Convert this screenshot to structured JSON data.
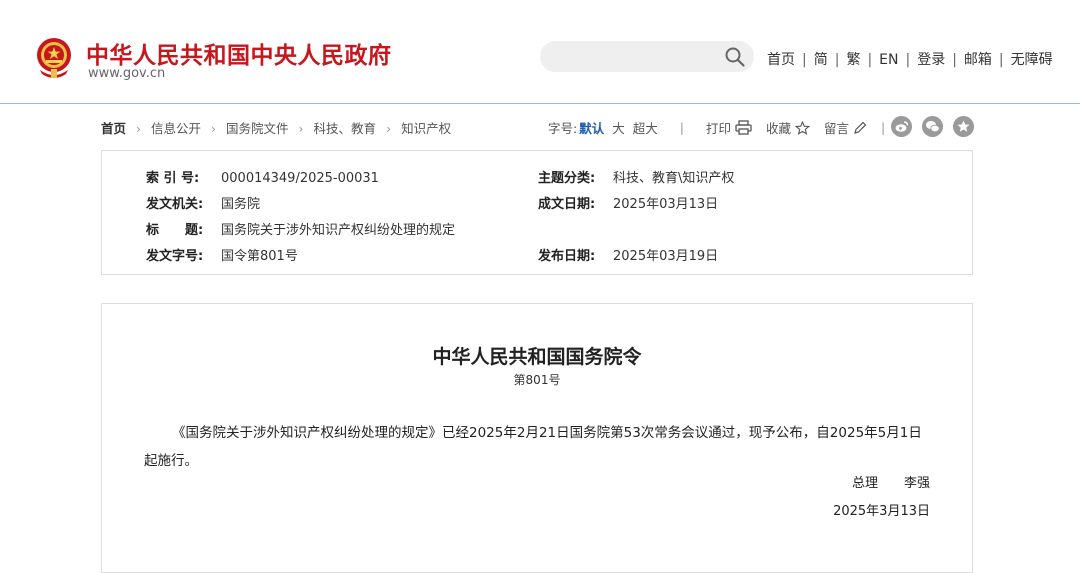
{
  "header": {
    "site_title": "中华人民共和国中央人民政府",
    "site_domain": "www.gov.cn",
    "emblem_icon": "national-emblem-icon",
    "search": {
      "value": "",
      "placeholder": ""
    },
    "nav": [
      "首页",
      "简",
      "繁",
      "EN",
      "登录",
      "邮箱",
      "无障碍"
    ]
  },
  "breadcrumb": [
    "首页",
    "信息公开",
    "国务院文件",
    "科技、教育",
    "知识产权"
  ],
  "toolbar": {
    "font_size_label": "字号:",
    "font_default": "默认",
    "font_large": "大",
    "font_xlarge": "超大",
    "print": "打印",
    "favorite": "收藏",
    "comment": "留言",
    "share_icons": [
      "weibo-icon",
      "wechat-icon",
      "star-icon"
    ]
  },
  "info": {
    "index_label": "索 引 号:",
    "index_value": "000014349/2025-00031",
    "category_label": "主题分类:",
    "category_value": "科技、教育\\知识产权",
    "issuer_label": "发文机关:",
    "issuer_value": "国务院",
    "date_written_label": "成文日期:",
    "date_written_value": "2025年03月13日",
    "title_label": "标　　题:",
    "title_value": "国务院关于涉外知识产权纠纷处理的规定",
    "doc_number_label": "发文字号:",
    "doc_number_value": "国令第801号",
    "publish_date_label": "发布日期:",
    "publish_date_value": "2025年03月19日"
  },
  "document": {
    "title": "中华人民共和国国务院令",
    "number": "第801号",
    "body": "《国务院关于涉外知识产权纠纷处理的规定》已经2025年2月21日国务院第53次常务会议通过，现予公布，自2025年5月1日起施行。",
    "signer_title": "总理",
    "signer_name": "李强",
    "sign_date": "2025年3月13日"
  },
  "colors": {
    "brand_red": "#c8161d",
    "accent_blue": "#1f5fae",
    "divider": "#9fb7cf"
  }
}
